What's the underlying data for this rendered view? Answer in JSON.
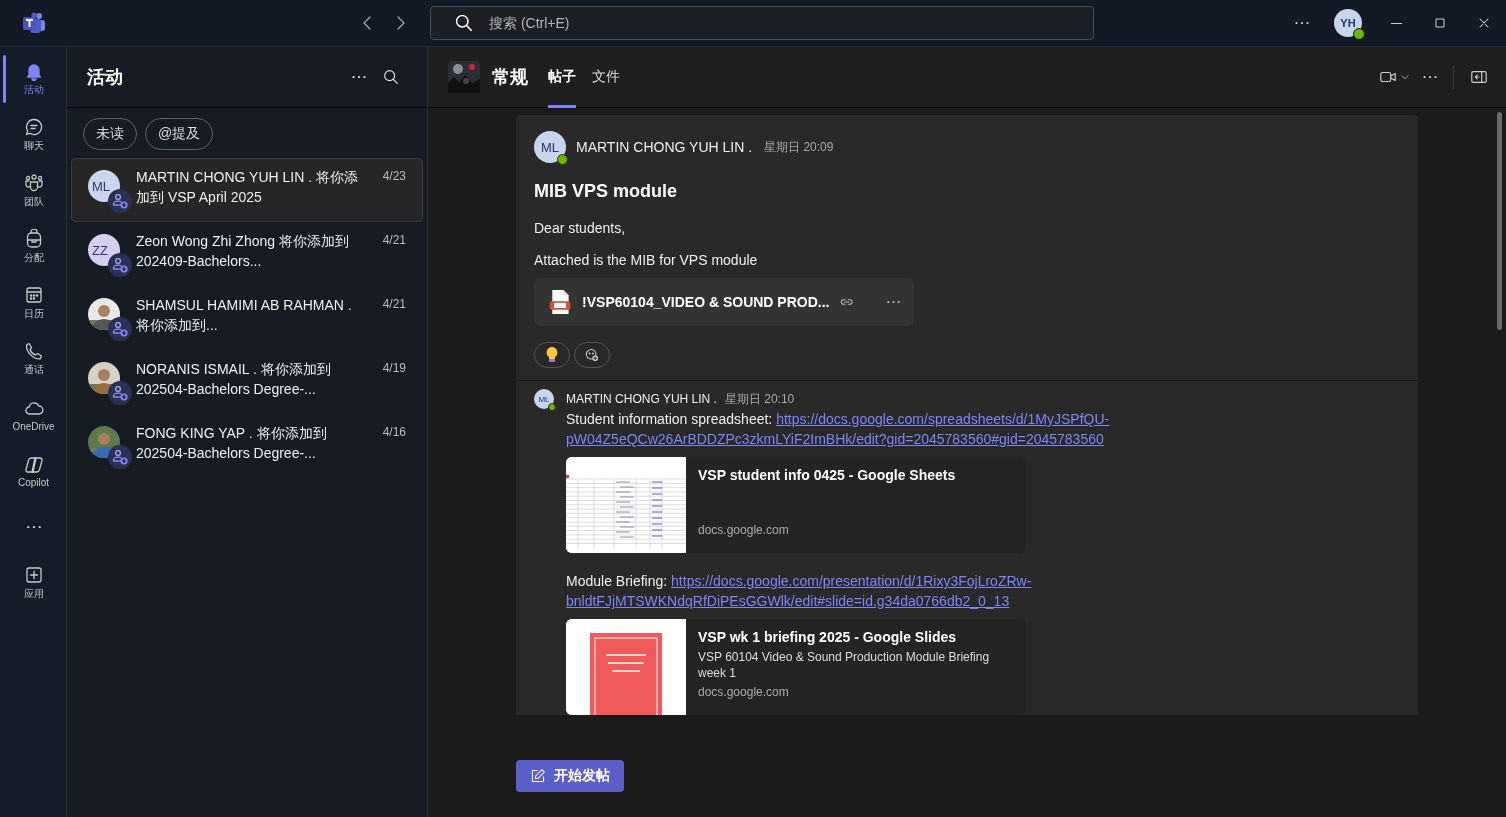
{
  "titlebar": {
    "search_placeholder": "搜索 (Ctrl+E)",
    "user": {
      "initials": "YH",
      "online": true
    }
  },
  "rail": [
    {
      "kind": "bell",
      "label": "活动",
      "selected": true
    },
    {
      "kind": "chat",
      "label": "聊天",
      "selected": false
    },
    {
      "kind": "teams",
      "label": "团队",
      "selected": false
    },
    {
      "kind": "backpack",
      "label": "分配",
      "selected": false
    },
    {
      "kind": "calendar",
      "label": "日历",
      "selected": false
    },
    {
      "kind": "phone",
      "label": "通话",
      "selected": false
    },
    {
      "kind": "cloud",
      "label": "OneDrive",
      "selected": false
    },
    {
      "kind": "copilot",
      "label": "Copilot",
      "selected": false
    },
    {
      "kind": "more",
      "selected": false
    },
    {
      "kind": "apps",
      "label": "应用",
      "selected": false
    }
  ],
  "activity": {
    "title": "活动",
    "filters": [
      {
        "label": "未读",
        "selected": false
      },
      {
        "label": "@提及",
        "selected": false
      }
    ],
    "items": [
      {
        "avatar": {
          "kind": "initials",
          "text": "ML"
        },
        "text": "MARTIN CHONG YUH LIN . 将你添加到 VSP April 2025",
        "date": "4/23",
        "selected": true
      },
      {
        "avatar": {
          "kind": "initials",
          "text": "ZZ"
        },
        "text": "Zeon Wong Zhi Zhong 将你添加到 202409-Bachelors...",
        "date": "4/21",
        "selected": false
      },
      {
        "text": "SHAMSUL HAMIMI AB RAHMAN . 将你添加到...",
        "date": "4/21",
        "selected": false
      },
      {
        "text": "NORANIS ISMAIL . 将你添加到 202504-Bachelors Degree-...",
        "date": "4/19",
        "selected": false
      },
      {
        "text": "FONG KING YAP . 将你添加到 202504-Bachelors Degree-...",
        "date": "4/16",
        "selected": false
      }
    ]
  },
  "channel": {
    "name": "常规",
    "tabs": [
      {
        "label": "帖子",
        "selected": true
      },
      {
        "label": "文件",
        "selected": false
      }
    ]
  },
  "post": {
    "author": {
      "initials": "ML",
      "name": "MARTIN CHONG YUH LIN .",
      "online": true
    },
    "time": "星期日 20:09",
    "title": "MIB VPS module",
    "paragraphs": [
      "Dear students,",
      "Attached is the MIB for VPS module"
    ],
    "attachment": {
      "name": "!VSP60104_VIDEO & SOUND PROD..."
    },
    "reactions": [
      {
        "kind": "bulb"
      },
      {
        "kind": "add"
      }
    ],
    "reply": {
      "author": {
        "initials": "ML",
        "name": "MARTIN CHONG YUH LIN .",
        "online": true
      },
      "time": "星期日 20:10",
      "blocks": [
        {
          "kind": "link",
          "label": "Student information spreadsheet:",
          "url": "https://docs.google.com/spreadsheets/d/1MyJSPfQU-pW04Z5eQCw26ArBDDZPc3zkmLYiF2ImBHk/edit?gid=2045783560#gid=2045783560"
        },
        {
          "kind": "preview",
          "title": "VSP student info 0425 - Google Sheets",
          "domain": "docs.google.com"
        },
        {
          "kind": "link",
          "label": "Module Briefing:",
          "url": "https://docs.google.com/presentation/d/1Rixy3FojLroZRw-bnldtFJjMTSWKNdqRfDiPEsGGWlk/edit#slide=id.g34da0766db2_0_13"
        },
        {
          "kind": "preview",
          "title": "VSP wk 1 briefing 2025 - Google Slides",
          "description": "VSP 60104 Video & Sound Production Module Briefing week 1",
          "domain": "docs.google.com"
        }
      ]
    }
  },
  "compose": {
    "label": "开始发帖"
  }
}
